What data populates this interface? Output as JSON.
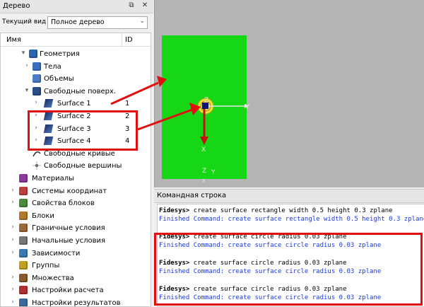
{
  "tree_panel": {
    "title": "Дерево",
    "view_label": "Текущий вид",
    "view_value": "Полное дерево",
    "col_name": "Имя",
    "col_id": "ID",
    "items": [
      {
        "label": "Геометрия",
        "icon": "geometry-icon",
        "arrow": "▾"
      },
      {
        "label": "Тела",
        "icon": "body-icon",
        "arrow": "›"
      },
      {
        "label": "Объемы",
        "icon": "volume-icon",
        "arrow": ""
      },
      {
        "label": "Свободные поверх.",
        "icon": "free-surface-icon",
        "arrow": "▾"
      },
      {
        "label": "Surface 1",
        "icon": "surface-icon",
        "arrow": "›",
        "id": "1"
      },
      {
        "label": "Surface 2",
        "icon": "surface-icon",
        "arrow": "›",
        "id": "2"
      },
      {
        "label": "Surface 3",
        "icon": "surface-icon",
        "arrow": "›",
        "id": "3"
      },
      {
        "label": "Surface 4",
        "icon": "surface-icon",
        "arrow": "›",
        "id": "4"
      },
      {
        "label": "Свободные кривые",
        "icon": "curve-icon",
        "arrow": ""
      },
      {
        "label": "Свободные вершины",
        "icon": "vertex-icon",
        "arrow": ""
      },
      {
        "label": "Материалы",
        "icon": "material-icon",
        "arrow": ""
      },
      {
        "label": "Системы координат",
        "icon": "coordinate-icon",
        "arrow": "›"
      },
      {
        "label": "Свойства блоков",
        "icon": "block-properties-icon",
        "arrow": "›"
      },
      {
        "label": "Блоки",
        "icon": "blocks-icon",
        "arrow": ""
      },
      {
        "label": "Граничные условия",
        "icon": "boundary-icon",
        "arrow": "›"
      },
      {
        "label": "Начальные условия",
        "icon": "initial-icon",
        "arrow": "›"
      },
      {
        "label": "Зависимости",
        "icon": "dependency-icon",
        "arrow": "›"
      },
      {
        "label": "Группы",
        "icon": "groups-icon",
        "arrow": ""
      },
      {
        "label": "Множества",
        "icon": "sets-icon",
        "arrow": "›"
      },
      {
        "label": "Настройки расчета",
        "icon": "settings-icon",
        "arrow": "›"
      },
      {
        "label": "Настройки результатов",
        "icon": "results-icon",
        "arrow": "›"
      }
    ]
  },
  "viewport": {
    "axis_y": "Y",
    "axis_x": "X",
    "axis_z": "Z",
    "mini_z": "Z",
    "mini_y": "Y",
    "mini_x": "X"
  },
  "command_panel": {
    "title": "Командная строка",
    "lines": [
      {
        "prompt": "Fidesys>",
        "text": " create surface rectangle width 0.5 height 0.3 zplane",
        "type": "c"
      },
      {
        "text": "Finished Command: create surface rectangle width 0.5 height 0.3 zplane",
        "type": "f"
      },
      {
        "text": "",
        "type": "c"
      },
      {
        "prompt": "Fidesys>",
        "text": " create surface circle radius 0.03 zplane",
        "type": "c"
      },
      {
        "text": "Finished Command: create surface circle radius 0.03 zplane",
        "type": "f"
      },
      {
        "text": "",
        "type": "c"
      },
      {
        "prompt": "Fidesys>",
        "text": " create surface circle radius 0.03 zplane",
        "type": "c"
      },
      {
        "text": "Finished Command: create surface circle radius 0.03 zplane",
        "type": "f"
      },
      {
        "text": "",
        "type": "c"
      },
      {
        "prompt": "Fidesys>",
        "text": " create surface circle radius 0.03 zplane",
        "type": "c"
      },
      {
        "text": "Finished Command: create surface circle radius 0.03 zplane",
        "type": "f"
      }
    ]
  },
  "colors": {
    "highlight": "#e01010",
    "surface": "#16d716",
    "finished": "#1a3ad8"
  }
}
